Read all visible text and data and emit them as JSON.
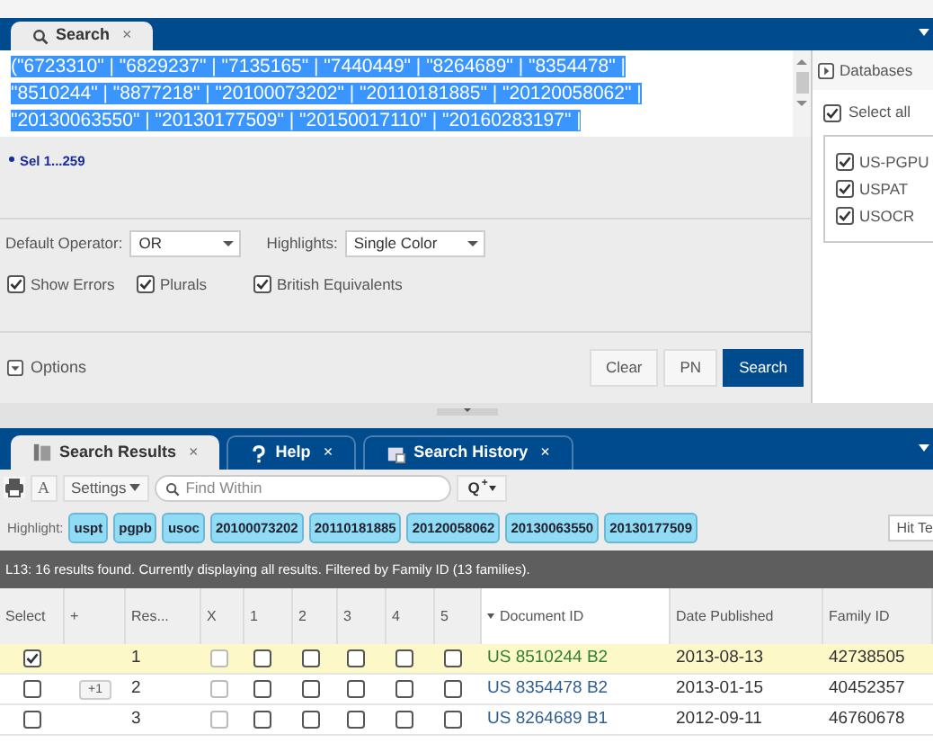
{
  "search_tab": {
    "label": "Search",
    "close": "×"
  },
  "query": {
    "lines": [
      "(\"6723310\" | \"6829237\" | \"7135165\" | \"7440449\" | \"8264689\" | \"8354478\" |",
      "\"8510244\" | \"8877218\" | \"20100073202\" | \"20110181885\" | \"20120058062\" |",
      "\"20130063550\" | \"20130177509\" | \"20150017110\" | \"20160283197\" |"
    ],
    "selected": true
  },
  "selection_note": "Sel 1...259",
  "databases": {
    "title": "Databases",
    "select_all": {
      "label": "Select all",
      "checked": true
    },
    "items": [
      {
        "label": "US-PGPU",
        "checked": true
      },
      {
        "label": "USPAT",
        "checked": true
      },
      {
        "label": "USOCR",
        "checked": true
      }
    ]
  },
  "default_operator": {
    "label": "Default Operator:",
    "value": "OR"
  },
  "highlights": {
    "label": "Highlights:",
    "value": "Single Color"
  },
  "options_checks": [
    {
      "label": "Show Errors",
      "checked": true
    },
    {
      "label": "Plurals",
      "checked": true
    },
    {
      "label": "British Equivalents",
      "checked": true
    }
  ],
  "options_toggle": "Options",
  "buttons": [
    {
      "label": "Clear",
      "kind": "plain"
    },
    {
      "label": "PN",
      "kind": "plain"
    },
    {
      "label": "Search",
      "kind": "primary"
    }
  ],
  "result_tabs": [
    {
      "label": "Search Results",
      "kind": "pages",
      "selected": true
    },
    {
      "label": "Help",
      "kind": "help",
      "selected": false
    },
    {
      "label": "Search History",
      "kind": "history",
      "selected": false
    }
  ],
  "tab_close": "×",
  "toolbar": {
    "font_button": "A",
    "settings": "Settings",
    "find_placeholder": "Find Within",
    "search_plus": "Q",
    "plus_mark": "+"
  },
  "highlight": {
    "label": "Highlight:",
    "terms": [
      "uspt",
      "pgpb",
      "usoc",
      "20100073202",
      "20110181885",
      "20120058062",
      "20130063550",
      "20130177509"
    ],
    "hit_button": "Hit Te"
  },
  "status": "L13:  16 results found. Currently displaying all results. Filtered by Family ID (13 families).",
  "table": {
    "columns": [
      {
        "label": "Select",
        "sorted": false
      },
      {
        "label": "+",
        "sorted": false
      },
      {
        "label": "Res...",
        "sorted": false
      },
      {
        "label": "X",
        "sorted": false
      },
      {
        "label": "1",
        "sorted": false
      },
      {
        "label": "2",
        "sorted": false
      },
      {
        "label": "3",
        "sorted": false
      },
      {
        "label": "4",
        "sorted": false
      },
      {
        "label": "5",
        "sorted": false
      },
      {
        "label": "Document ID",
        "sorted": true
      },
      {
        "label": "Date Published",
        "sorted": false
      },
      {
        "label": "Family ID",
        "sorted": false
      }
    ],
    "rows": [
      {
        "selected": true,
        "result": "1",
        "marks": [
          false,
          false,
          false,
          false,
          false,
          false
        ],
        "document_id": "US 8510244 B2",
        "date": "2013-08-13",
        "family": "42738505"
      },
      {
        "selected": false,
        "plus": "+1",
        "result": "2",
        "marks": [
          false,
          false,
          false,
          false,
          false,
          false
        ],
        "document_id": "US 8354478 B2",
        "date": "2013-01-15",
        "family": "40452357"
      },
      {
        "selected": false,
        "result": "3",
        "marks": [
          false,
          false,
          false,
          false,
          false,
          false
        ],
        "document_id": "US 8264689 B1",
        "date": "2012-09-11",
        "family": "46760678"
      }
    ]
  }
}
